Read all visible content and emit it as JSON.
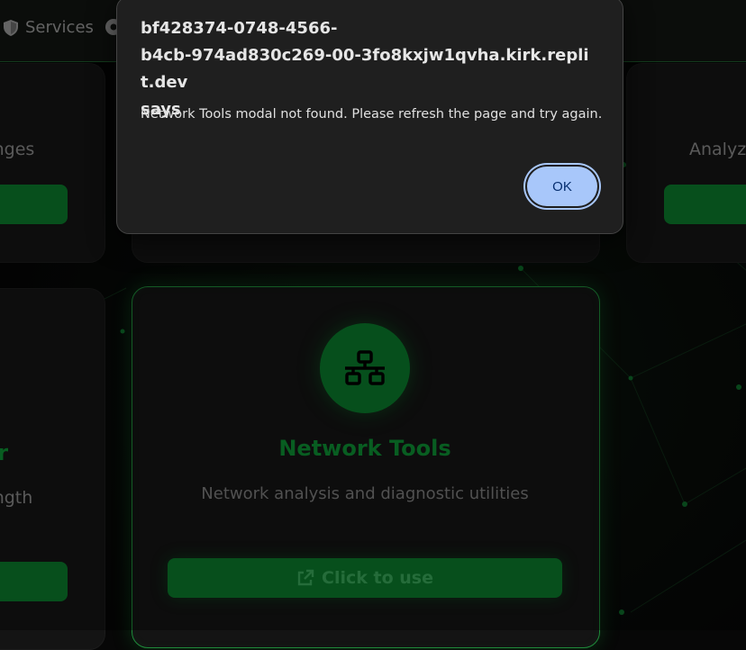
{
  "nav": {
    "services_label": "Services",
    "services_icon": "shield-icon",
    "next_icon": "gear-icon"
  },
  "cards": {
    "left_top_text": "anges",
    "right_top_text": "Analyze",
    "left_bottom_title": "er",
    "left_bottom_text": "ength"
  },
  "tool": {
    "icon": "network-icon",
    "title": "Network Tools",
    "description": "Network analysis and diagnostic utilities",
    "button_label": "Click to use",
    "button_icon": "external-link-icon"
  },
  "dialog": {
    "title_line1": "bf428374-0748-4566-",
    "title_line2": "b4cb-974ad830c269-00-3fo8kxjw1qvha.kirk.replit.dev",
    "title_line3": "says",
    "message": "Network Tools modal not found. Please refresh the page and try again.",
    "ok_label": "OK"
  },
  "colors": {
    "accent": "#0b7a2b",
    "title_green": "#0d8f33",
    "dialog_bg": "#1f1f1f",
    "ok_bg": "#a8c7fa"
  }
}
